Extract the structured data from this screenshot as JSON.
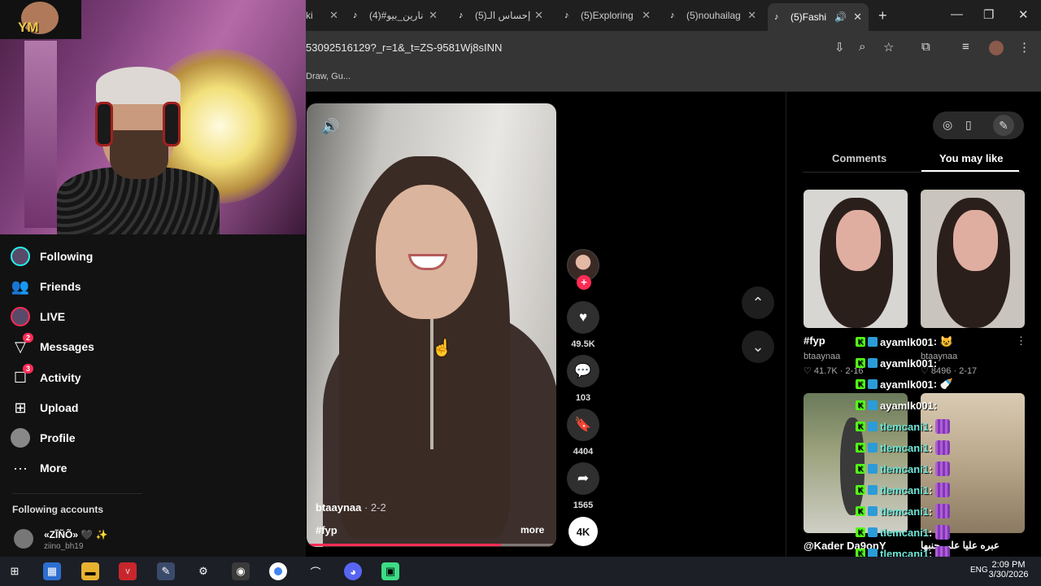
{
  "browser": {
    "tabs": [
      {
        "label": "ki",
        "active": false
      },
      {
        "label": "(4)#نارين_بيو",
        "active": false
      },
      {
        "label": "(5)إحساس الـ",
        "active": false
      },
      {
        "label": "(5)Exploring",
        "active": false
      },
      {
        "label": "(5)nouhailag",
        "active": false
      },
      {
        "label": "(5)Fashi",
        "active": true
      }
    ],
    "url": "53092516129?_r=1&_t=ZS-9581Wj8sINN",
    "bookmarks_text": "Draw, Gu...",
    "new_tab": "+",
    "win_controls": {
      "minimize": "—",
      "maximize": "❐",
      "close": "✕"
    }
  },
  "webcam": {
    "logo_text": "YM"
  },
  "sidebar": {
    "items": [
      {
        "label": "Following",
        "icon": "following-avatar-icon",
        "badge": ""
      },
      {
        "label": "Friends",
        "icon": "friends-icon",
        "badge": ""
      },
      {
        "label": "LIVE",
        "icon": "live-icon",
        "badge": ""
      },
      {
        "label": "Messages",
        "icon": "messages-icon",
        "badge": "2"
      },
      {
        "label": "Activity",
        "icon": "activity-icon",
        "badge": "3"
      },
      {
        "label": "Upload",
        "icon": "upload-icon",
        "badge": ""
      },
      {
        "label": "Profile",
        "icon": "profile-icon",
        "badge": ""
      },
      {
        "label": "More",
        "icon": "more-icon",
        "badge": ""
      }
    ],
    "following_header": "Following accounts",
    "account": {
      "name": "«ZĨÑÕ» 🖤 ✨",
      "handle": "ziino_bh19"
    }
  },
  "video": {
    "author": "btaaynaa",
    "date": " · 2-2",
    "hashtag": "#fyp",
    "more": "more",
    "progress": 0.78
  },
  "actions": {
    "likes": "49.5K",
    "comments": "103",
    "saves": "4404",
    "shares": "1565",
    "quality": "4K",
    "follow": "+"
  },
  "right_panel": {
    "tabs": [
      "Comments",
      "You may like"
    ],
    "active_tab": "You may like",
    "thumbnails": [
      {
        "title": "#fyp",
        "author": "btaaynaa",
        "stats": "♡ 41.7K · 2-16"
      },
      {
        "title": "",
        "author": "btaaynaa",
        "stats": "♡ 8496 · 2-17"
      },
      {
        "title": "@Kader Da9onY",
        "author": "",
        "stats": ""
      },
      {
        "title": "عبره عليا على جنبها",
        "author": "",
        "stats": ""
      }
    ]
  },
  "chat": [
    {
      "user": "ayamlk001",
      "msg": " : 😺",
      "kind": "text"
    },
    {
      "user": "ayamlk001",
      "msg": " : ",
      "kind": "text"
    },
    {
      "user": "ayamlk001",
      "msg": " : 🍼",
      "kind": "text"
    },
    {
      "user": "ayamlk001",
      "msg": " : ",
      "kind": "text"
    },
    {
      "user": "tlemcani1",
      "msg": " : ",
      "kind": "emote"
    },
    {
      "user": "tlemcani1",
      "msg": " : ",
      "kind": "emote"
    },
    {
      "user": "tlemcani1",
      "msg": " : ",
      "kind": "emote"
    },
    {
      "user": "tlemcani1",
      "msg": " : ",
      "kind": "emote"
    },
    {
      "user": "tlemcani1",
      "msg": " : ",
      "kind": "emote"
    },
    {
      "user": "tlemcani1",
      "msg": " : ",
      "kind": "emote"
    },
    {
      "user": "tlemcani1",
      "msg": " : ",
      "kind": "emote"
    },
    {
      "user": "tlemcani1",
      "msg": " : ",
      "kind": "emote"
    }
  ],
  "taskbar": {
    "time": "2:09 PM",
    "date": "3/30/2026",
    "lang": "ENG"
  }
}
